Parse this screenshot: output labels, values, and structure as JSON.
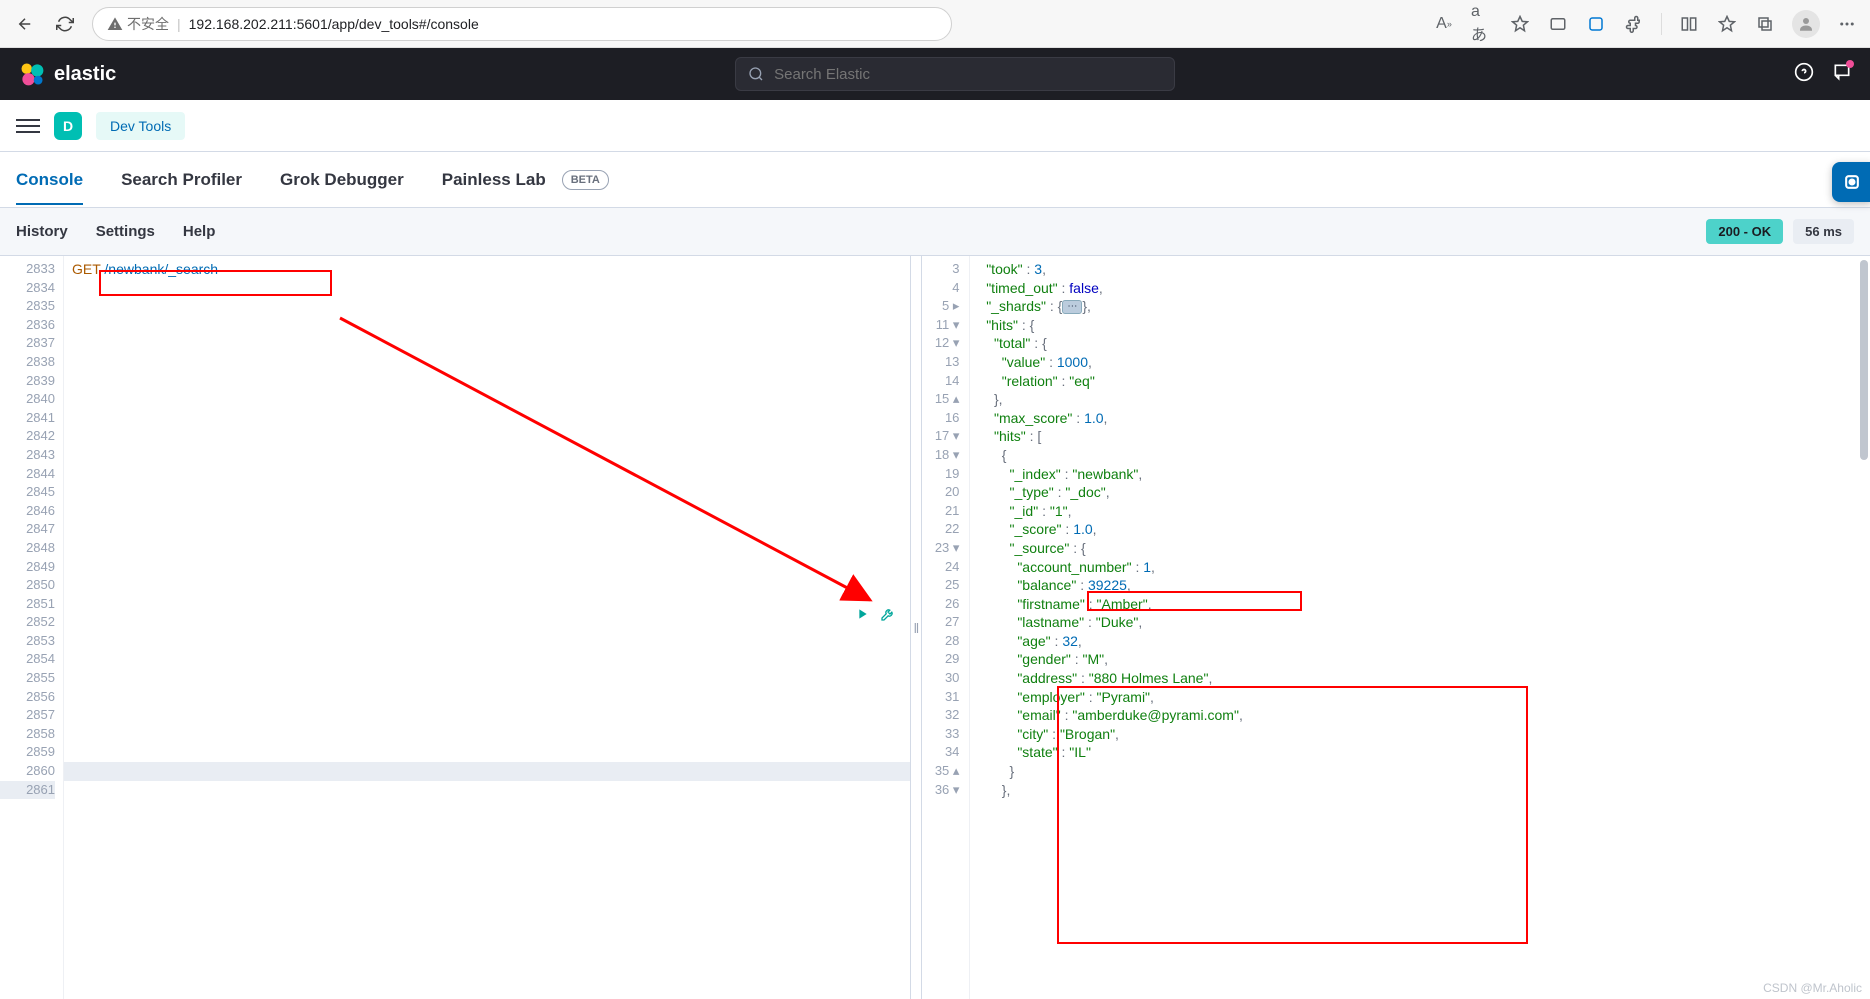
{
  "browser": {
    "insecure_label": "不安全",
    "url": "192.168.202.211:5601/app/dev_tools#/console"
  },
  "header": {
    "brand": "elastic",
    "search_placeholder": "Search Elastic"
  },
  "nav": {
    "space_initial": "D",
    "breadcrumb": "Dev Tools"
  },
  "tabs": {
    "console": "Console",
    "profiler": "Search Profiler",
    "grok": "Grok Debugger",
    "painless": "Painless Lab",
    "painless_badge": "BETA"
  },
  "subtool": {
    "history": "History",
    "settings": "Settings",
    "help": "Help",
    "status": "200 - OK",
    "time": "56 ms"
  },
  "request": {
    "lines": [
      "2833",
      "2834",
      "2835",
      "2836",
      "2837",
      "2838",
      "2839",
      "2840",
      "2841",
      "2842",
      "2843",
      "2844",
      "2845",
      "2846",
      "2847",
      "2848",
      "2849",
      "2850",
      "2851",
      "2852",
      "2853",
      "2854",
      "2855",
      "2856",
      "2857",
      "2858",
      "2859",
      "2860",
      "2861"
    ],
    "method": "GET",
    "path": "/newbank/_search"
  },
  "response": {
    "gutter": [
      "3",
      "4",
      "5 ▸",
      "11 ▾",
      "12 ▾",
      "13",
      "14",
      "15 ▴",
      "16",
      "17 ▾",
      "18 ▾",
      "19",
      "20",
      "21",
      "22",
      "23 ▾",
      "24",
      "25",
      "26",
      "27",
      "28",
      "29",
      "30",
      "31",
      "32",
      "33",
      "34",
      "35 ▴",
      "36 ▾"
    ],
    "took": 3,
    "timed_out": "false",
    "hits_total_value": 1000,
    "hits_total_relation": "eq",
    "max_score": "1.0",
    "doc": {
      "_index": "newbank",
      "_type": "_doc",
      "_id": "1",
      "_score": "1.0",
      "source": {
        "account_number": 1,
        "balance": 39225,
        "firstname": "Amber",
        "lastname": "Duke",
        "age": 32,
        "gender": "M",
        "address": "880 Holmes Lane",
        "employer": "Pyrami",
        "email": "amberduke@pyrami.com",
        "city": "Brogan",
        "state": "IL"
      }
    }
  },
  "watermark": "CSDN @Mr.Aholic"
}
